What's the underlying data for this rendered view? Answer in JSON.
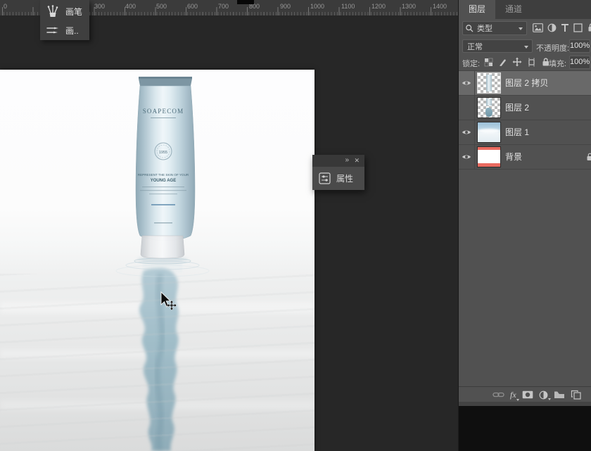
{
  "ruler": {
    "labels": [
      "0",
      "300",
      "400",
      "500",
      "600",
      "700",
      "800",
      "900",
      "1000",
      "1100",
      "1200",
      "1300",
      "1400"
    ]
  },
  "brush_flyout": {
    "items": [
      {
        "label": "画笔"
      },
      {
        "label": "画.."
      }
    ]
  },
  "properties_panel": {
    "collapse_icon": "»",
    "close_icon": "✕",
    "title": "属性"
  },
  "layers_panel": {
    "tabs": [
      {
        "label": "图层",
        "active": true
      },
      {
        "label": "通道",
        "active": false
      }
    ],
    "filter_type_label": "类型",
    "blend_mode": "正常",
    "opacity_label": "不透明度:",
    "opacity_value": "100%",
    "lock_label": "锁定:",
    "fill_label": "填充:",
    "fill_value": "100%",
    "footer_fx_label": "fx",
    "layers": [
      {
        "name": "图层 2 拷贝",
        "visible": true,
        "selected": true
      },
      {
        "name": "图层 2",
        "visible": false,
        "selected": false
      },
      {
        "name": "图层 1",
        "visible": true,
        "selected": false
      },
      {
        "name": "背景",
        "visible": true,
        "selected": false,
        "locked": true
      }
    ]
  },
  "canvas": {
    "product": {
      "brand": "SOAPECOM",
      "seal_year": "1955",
      "tagline_line1": "REPRESENT THE SKIN OF YOUR",
      "tagline_line2": "YOUNG AGE"
    }
  },
  "colors": {
    "panel_bg": "#515151",
    "selected_layer_bg": "#696969",
    "pasteboard": "#272727",
    "background_thumb_red": "#e96a5f",
    "reflection_teal": "#8fb0bd"
  }
}
